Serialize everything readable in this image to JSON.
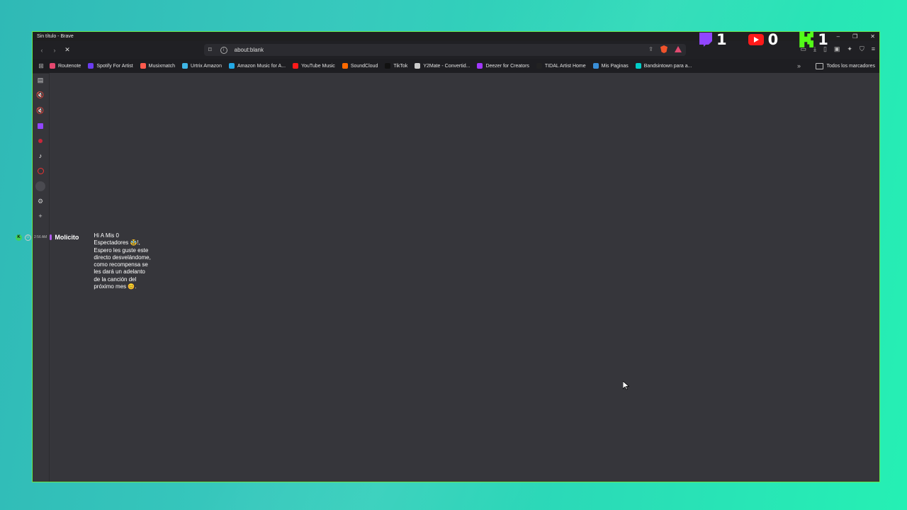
{
  "window": {
    "title": "Sin título - Brave",
    "controls": [
      "–",
      "❐",
      "✕"
    ]
  },
  "navbar": {
    "url": "about:blank",
    "reload_icon": "stop-icon"
  },
  "bookmarks": {
    "items": [
      {
        "label": "Routenote",
        "color": "#e5486f"
      },
      {
        "label": "Spotify For Artist",
        "color": "#6b3cf0"
      },
      {
        "label": "Musixmatch",
        "color": "#ff5a4d"
      },
      {
        "label": "Urtrix Amazon",
        "color": "#3fb6e6"
      },
      {
        "label": "Amazon Music for A...",
        "color": "#23a9e6"
      },
      {
        "label": "YouTube Music",
        "color": "#ff1a1a"
      },
      {
        "label": "SoundCloud",
        "color": "#ff6a00"
      },
      {
        "label": "TikTok",
        "color": "#111111"
      },
      {
        "label": "Y2Mate - Convertid...",
        "color": "#cccccc"
      },
      {
        "label": "Deezer for Creators",
        "color": "#a238ff"
      },
      {
        "label": "TIDAL Artist Home",
        "color": "#222222"
      },
      {
        "label": "Mis Paginas",
        "color": "#3a8fd8"
      },
      {
        "label": "Bandsintown para a...",
        "color": "#00cec8"
      }
    ],
    "all_bookmarks": "Todos los marcadores"
  },
  "chat": {
    "time": "2:56 AM",
    "username": "Molicito",
    "message": "Hi A Mis 0 Espectadores 🥸!, Espero les guste este directo desvelándome, como recompensa se les dará un adelanto de la canción del próximo mes 😊."
  },
  "stats": {
    "twitch": "1",
    "youtube": "0",
    "kick": "1"
  }
}
